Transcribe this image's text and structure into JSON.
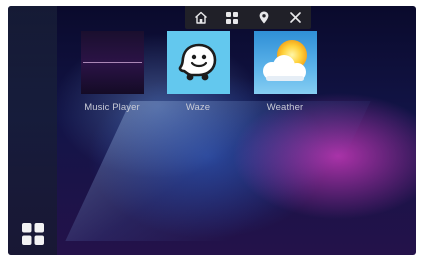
{
  "topbar": {
    "icons": [
      "home-icon",
      "apps-grid-icon",
      "location-pin-icon",
      "close-icon"
    ]
  },
  "apps": [
    {
      "label": "Music Player",
      "icon": "music-waveform-icon"
    },
    {
      "label": "Waze",
      "icon": "waze-icon"
    },
    {
      "label": "Weather",
      "icon": "weather-sun-cloud-icon"
    }
  ],
  "sidebar": {
    "apps_button_icon": "apps-grid-icon"
  },
  "colors": {
    "waze_bg": "#63c8ee",
    "topbar_bg": "#232328",
    "label_text": "#c9cbd6"
  }
}
